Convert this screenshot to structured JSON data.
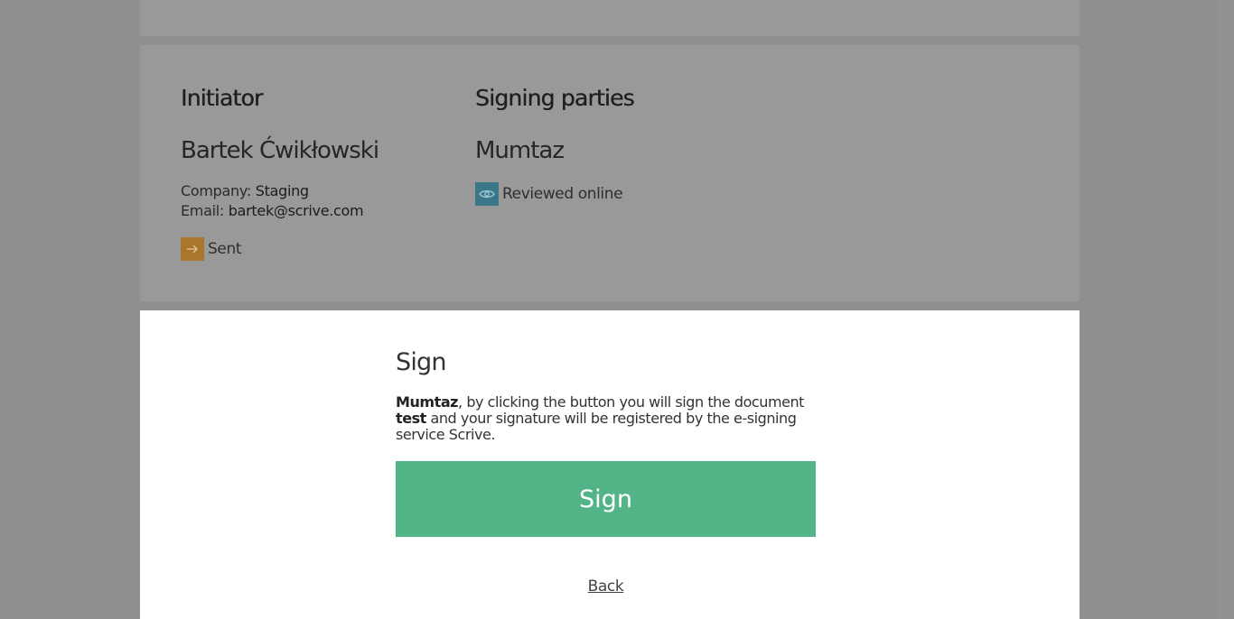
{
  "parties": {
    "initiator": {
      "heading": "Initiator",
      "name": "Bartek Ćwikłowski",
      "company_label": "Company:",
      "company_value": "Staging",
      "email_label": "Email:",
      "email_value": "bartek@scrive.com",
      "status_icon": "arrow-right-icon",
      "status_text": "Sent",
      "status_color": "#a8772c"
    },
    "signing": {
      "heading": "Signing parties",
      "name": "Mumtaz",
      "status_icon": "eye-icon",
      "status_text": "Reviewed online",
      "status_color": "#3a7788"
    }
  },
  "sign_dialog": {
    "title": "Sign",
    "signer_name": "Mumtaz",
    "text_before_doc": ", by clicking the button you will sign the document ",
    "document_name": "test",
    "text_after_doc": " and your signature will be registered by the e-signing service Scrive.",
    "button_label": "Sign",
    "button_color": "#53b587",
    "back_label": "Back"
  }
}
